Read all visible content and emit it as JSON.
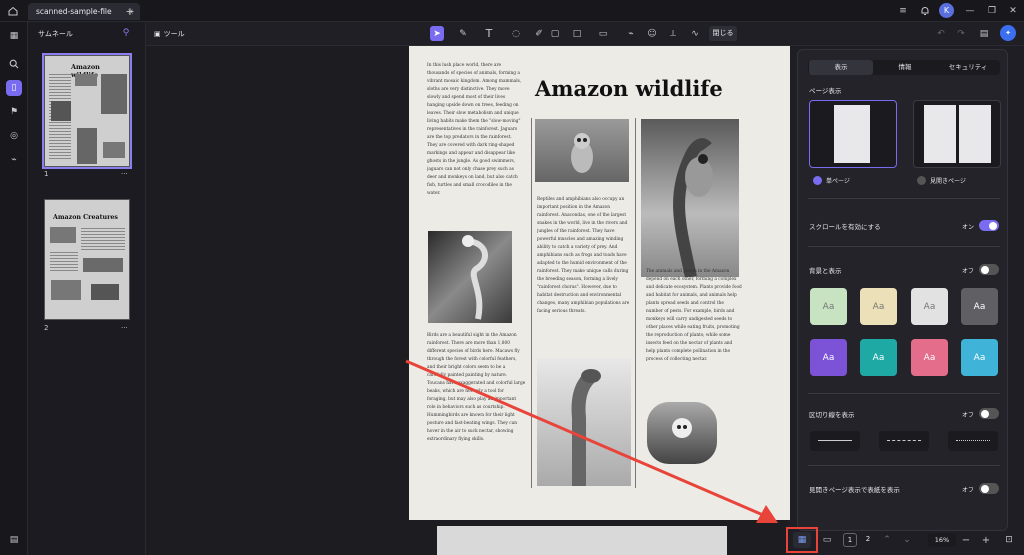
{
  "titlebar": {
    "tab_label": "scanned-sample-file",
    "tab_close": "×",
    "add_tab": "+",
    "avatar_letter": "K"
  },
  "thumbnails": {
    "title": "サムネール",
    "pages": [
      {
        "number": "1",
        "heading": "Amazon wildlife",
        "menu": "···"
      },
      {
        "number": "2",
        "heading": "Amazon Creatures",
        "menu": "···"
      }
    ]
  },
  "toolbar": {
    "tools_label": "ツール",
    "close_label": "閉じる"
  },
  "document": {
    "title": "Amazon wildlife",
    "col1_text": "In this lush place world, there are\nthousands of species of animals, forming a\nvibrant mosaic kingdom. Among mammals,\nsloths are very distinctive. They move\nslowly and spend most of their lives\nhanging upside down on trees, feeding on\nleaves. Their slow metabolism and unique\nliving habits make them the \"slow-moving\"\nrepresentatives in the rainforest. Jaguars\nare the top predators in the rainforest.\nThey are covered with dark ring-shaped\nmarkings and appear and disappear like\nghosts in the jungle. As good swimmers,\njaguars can not only chase prey such as\ndeer and monkeys on land, but also catch\nfish, turtles and small crocodiles in the\nwater.",
    "col1_text2": "Birds are a beautiful sight in the Amazon\nrainforest. There are more than 1,800\ndifferent species of birds here. Macaws fly\nthrough the forest with colorful feathers,\nand their bright colors seem to be a\ncarefully painted painting by nature.\nToucans have exaggerated and colorful large\nbeaks, which are not only a tool for\nforaging, but may also play an important\nrole in behaviors such as courtship.\nHummingbirds are known for their light\nposture and fast-beating wings. They can\nhover in the air to suck nectar, showing\nextraordinary flying skills.",
    "col2_text": "Reptiles and amphibians also occupy an\nimportant position in the Amazon\nrainforest. Anacondas, one of the largest\nsnakes in the world, live in the rivers and\njungles of the rainforest. They have\npowerful muscles and amazing winding\nability to catch a variety of prey. And\namphibians such as frogs and toads have\nadapted to the humid environment of the\nrainforest. They make unique calls during\nthe breeding season, forming a lively\n\"rainforest chorus\". However, due to\nhabitat destruction and environmental\nchanges, many amphibian populations are\nfacing serious threats.",
    "col3_text": "The animals and plants in the Amazon\ndepend on each other, forming a complex\nand delicate ecosystem. Plants provide food\nand habitat for animals, and animals help\nplants spread seeds and control the\nnumber of pests. For example, birds and\nmonkeys will carry undigested seeds to\nother places while eating fruits, promoting\nthe reproduction of plants; while some\ninsects feed on the nectar of plants and\nhelp plants complete pollination in the\nprocess of collecting nectar."
  },
  "panel": {
    "tabs": [
      "表示",
      "情報",
      "セキュリティ"
    ],
    "page_display_title": "ページ表示",
    "single_page": "単ページ",
    "two_page": "見開きページ",
    "scroll_label": "スクロールを有効にする",
    "scroll_state": "オン",
    "background_label": "背景と表示",
    "background_state": "オフ",
    "swatch_text": "Aa",
    "separator_label": "区切り線を表示",
    "separator_state": "オフ",
    "cover_label": "見開きページ表示で表紙を表示",
    "cover_state": "オフ",
    "swatches": [
      "#c7e3c2",
      "#ece0b8",
      "#e2e2e2",
      "#5f5f64",
      "#7c53d6",
      "#1fa9a4",
      "#e36d8a",
      "#3fb3d8"
    ]
  },
  "bottom": {
    "page1": "1",
    "page2": "2",
    "zoom": "16%",
    "zoom_out": "−",
    "zoom_in": "+"
  },
  "colors": {
    "accent": "#7a6cf0",
    "annotation": "#e8443a"
  }
}
